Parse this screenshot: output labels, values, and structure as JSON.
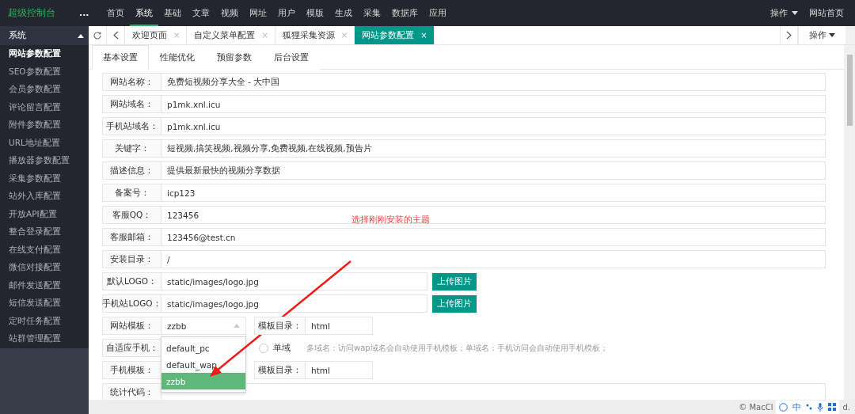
{
  "header": {
    "logo": "超级控制台",
    "more": "...",
    "nav": [
      {
        "label": "首页",
        "selected": false
      },
      {
        "label": "系统",
        "selected": true
      },
      {
        "label": "基础",
        "selected": false
      },
      {
        "label": "文章",
        "selected": false
      },
      {
        "label": "视频",
        "selected": false
      },
      {
        "label": "网址",
        "selected": false
      },
      {
        "label": "用户",
        "selected": false
      },
      {
        "label": "模版",
        "selected": false
      },
      {
        "label": "生成",
        "selected": false
      },
      {
        "label": "采集",
        "selected": false
      },
      {
        "label": "数据库",
        "selected": false
      },
      {
        "label": "应用",
        "selected": false
      }
    ],
    "actions": "操作",
    "home": "网站首页"
  },
  "sidebar": {
    "title": "系统",
    "expanded": true,
    "items": [
      {
        "label": "网站参数配置",
        "selected": true
      },
      {
        "label": "SEO参数配置",
        "selected": false
      },
      {
        "label": "会员参数配置",
        "selected": false
      },
      {
        "label": "评论留言配置",
        "selected": false
      },
      {
        "label": "附件参数配置",
        "selected": false
      },
      {
        "label": "URL地址配置",
        "selected": false
      },
      {
        "label": "播放器参数配置",
        "selected": false
      },
      {
        "label": "采集参数配置",
        "selected": false
      },
      {
        "label": "站外入库配置",
        "selected": false
      },
      {
        "label": "开放API配置",
        "selected": false
      },
      {
        "label": "整合登录配置",
        "selected": false
      },
      {
        "label": "在线支付配置",
        "selected": false
      },
      {
        "label": "微信对接配置",
        "selected": false
      },
      {
        "label": "邮件发送配置",
        "selected": false
      },
      {
        "label": "短信发送配置",
        "selected": false
      },
      {
        "label": "定时任务配置",
        "selected": false
      },
      {
        "label": "站群管理配置",
        "selected": false
      }
    ]
  },
  "page_tabs": {
    "tabs": [
      {
        "label": "欢迎页面",
        "close": "×",
        "selected": false
      },
      {
        "label": "自定义菜单配置",
        "close": "×",
        "selected": false
      },
      {
        "label": "狐狸采集资源",
        "close": "×",
        "selected": false
      },
      {
        "label": "网站参数配置",
        "close": "×",
        "selected": true
      }
    ],
    "actions": "操作"
  },
  "settings_tabs": [
    {
      "label": "基本设置",
      "selected": true
    },
    {
      "label": "性能优化",
      "selected": false
    },
    {
      "label": "预留参数",
      "selected": false
    },
    {
      "label": "后台设置",
      "selected": false
    }
  ],
  "form": [
    {
      "kind": "text",
      "label": "网站名称：",
      "value": "免费短视频分享大全 - 大中国"
    },
    {
      "kind": "text",
      "label": "网站域名：",
      "value": "p1mk.xnl.icu"
    },
    {
      "kind": "text",
      "label": "手机站域名：",
      "value": "p1mk.xnl.icu"
    },
    {
      "kind": "text",
      "label": "关键字：",
      "value": "短视频,搞笑视频,视频分享,免费视频,在线视频,预告片"
    },
    {
      "kind": "text",
      "label": "描述信息：",
      "value": "提供最新最快的视频分享数据"
    },
    {
      "kind": "text",
      "label": "备案号：",
      "value": "icp123"
    },
    {
      "kind": "text",
      "label": "客服QQ：",
      "value": "123456"
    },
    {
      "kind": "text",
      "label": "客服邮箱：",
      "value": "123456@test.cn"
    },
    {
      "kind": "text",
      "label": "安装目录：",
      "value": "/"
    },
    {
      "kind": "upload",
      "label": "默认LOGO：",
      "value": "static/images/logo.jpg",
      "button": "上传图片"
    },
    {
      "kind": "upload",
      "label": "手机站LOGO：",
      "value": "static/images/logo.jpg",
      "button": "上传图片"
    },
    {
      "kind": "select",
      "label": "网站模板：",
      "value": "zzbb",
      "expanded": true,
      "options": [
        {
          "label": "default_pc",
          "selected": false
        },
        {
          "label": "default_wap",
          "selected": false
        },
        {
          "label": "zzbb",
          "selected": true
        }
      ],
      "dir_label": "模板目录：",
      "dir_value": "html"
    },
    {
      "kind": "radio",
      "label": "自适应手机：",
      "option": {
        "label": "单域",
        "selected": false
      },
      "hint": "多域名：访问wap域名会自动使用手机模板；单域名：手机访问会自动使用手机模板；"
    },
    {
      "kind": "select",
      "label": "手机模板：",
      "dir_label": "模板目录：",
      "dir_value": "html"
    },
    {
      "kind": "textarea",
      "label": "统计代码："
    }
  ],
  "annotation": "选择刚刚安装的主题",
  "footer": {
    "copyright": "© MacCl",
    "tail": "d.",
    "ime": "中"
  }
}
